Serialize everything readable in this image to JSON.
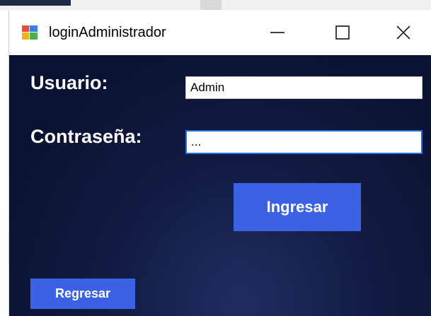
{
  "window": {
    "title": "loginAdministrador"
  },
  "form": {
    "user_label": "Usuario:",
    "user_value": "Admin",
    "pass_label": "Contraseña:",
    "pass_value": "..."
  },
  "buttons": {
    "ingresar": "Ingresar",
    "regresar": "Regresar"
  },
  "icons": {
    "app": "app-form-icon",
    "minimize": "minimize-icon",
    "maximize": "maximize-icon",
    "close": "close-icon"
  },
  "colors": {
    "client_bg": "#111943",
    "button_bg": "#3b62e3",
    "focus_border": "#1e6fd6"
  }
}
